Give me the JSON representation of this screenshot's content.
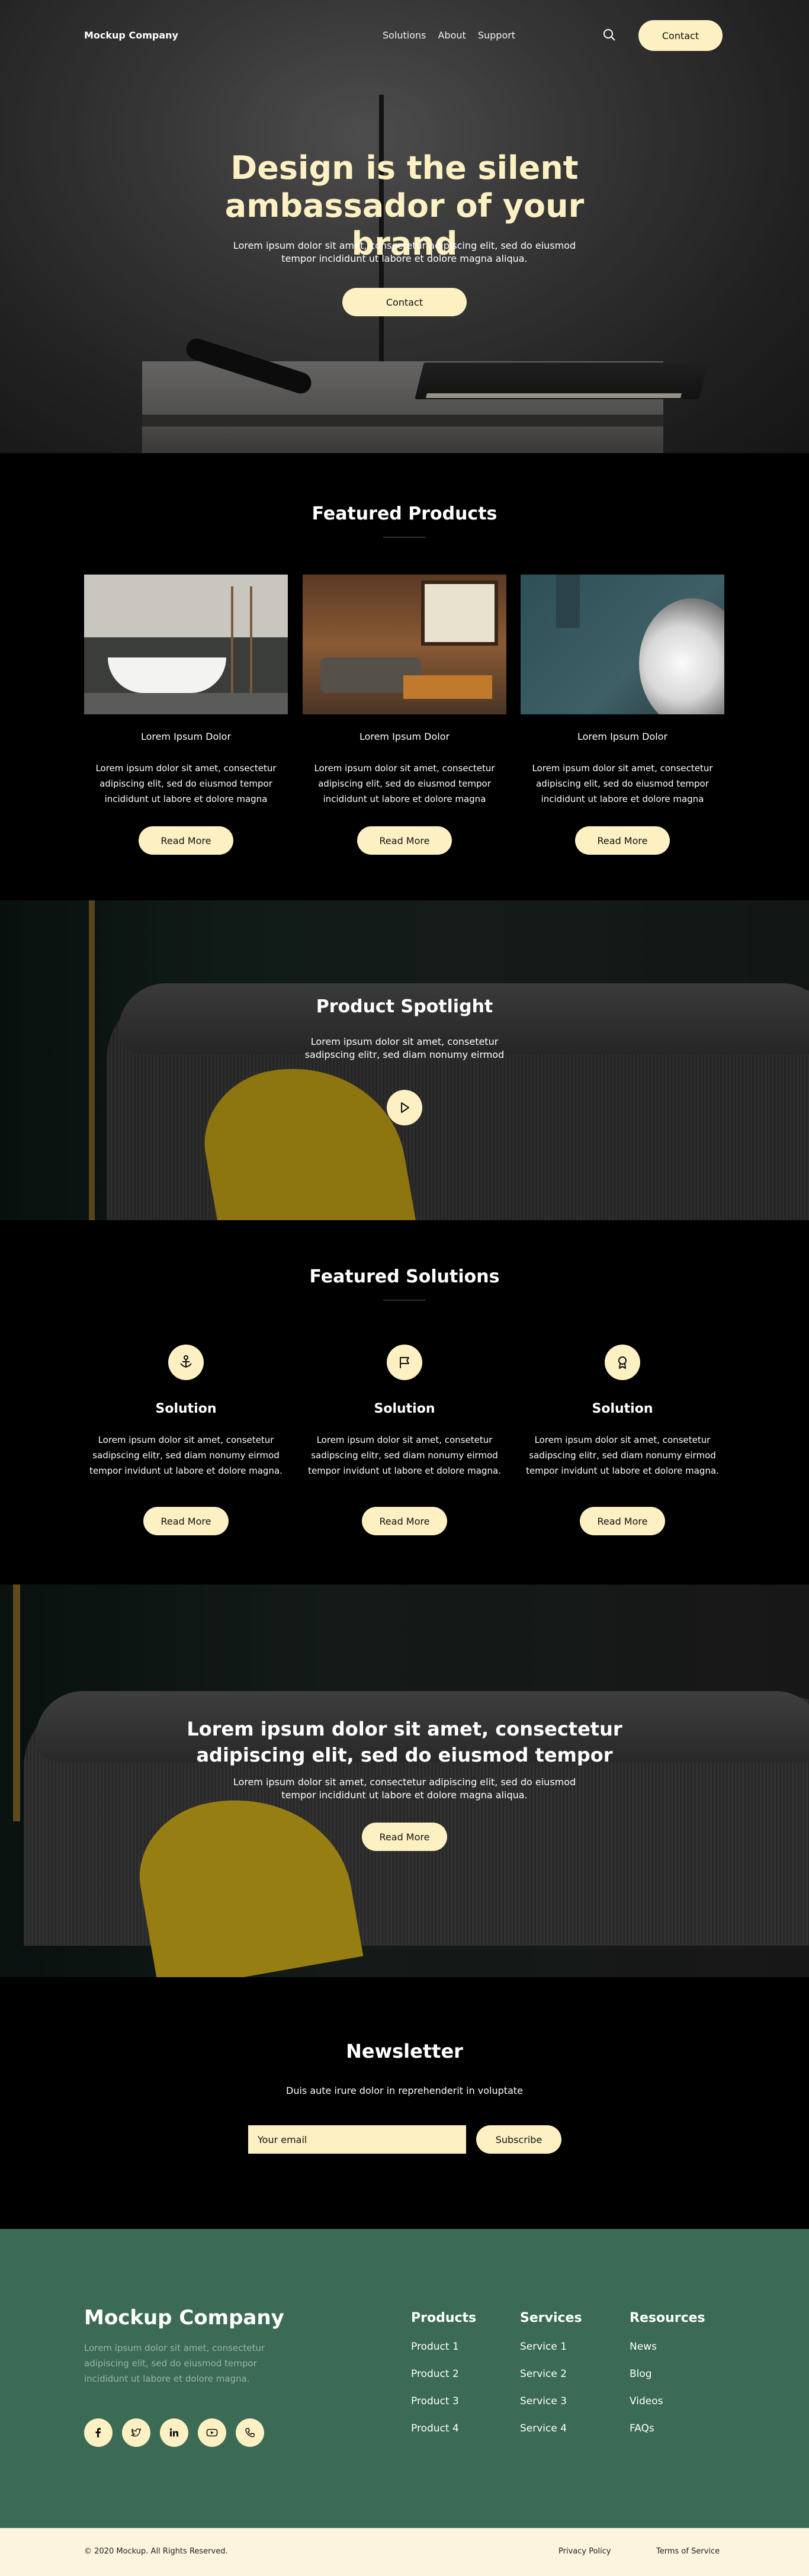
{
  "nav": {
    "logo": "Mockup Company",
    "links": [
      "Solutions",
      "About",
      "Support"
    ],
    "contact": "Contact",
    "search_icon": "search-icon"
  },
  "hero": {
    "title": "Design is the silent ambassador of your brand",
    "subtitle": "Lorem ipsum dolor sit amet, consectetur adipiscing elit, sed do eiusmod tempor incididunt ut labore et dolore magna aliqua.",
    "button": "Contact"
  },
  "featured_products": {
    "title": "Featured Products",
    "cards": [
      {
        "title": "Lorem Ipsum Dolor",
        "text": "Lorem ipsum dolor sit amet, consectetur adipiscing elit, sed do eiusmod tempor incididunt ut labore et dolore magna",
        "button": "Read More"
      },
      {
        "title": "Lorem Ipsum Dolor",
        "text": "Lorem ipsum dolor sit amet, consectetur adipiscing elit, sed do eiusmod tempor incididunt ut labore et dolore magna",
        "button": "Read More"
      },
      {
        "title": "Lorem Ipsum Dolor",
        "text": "Lorem ipsum dolor sit amet, consectetur adipiscing elit, sed do eiusmod tempor incididunt ut labore et dolore magna",
        "button": "Read More"
      }
    ]
  },
  "spotlight": {
    "title": "Product Spotlight",
    "subtitle": "Lorem ipsum dolor sit amet, consetetur sadipscing elitr, sed diam nonumy eirmod"
  },
  "solutions": {
    "title": "Featured Solutions",
    "items": [
      {
        "icon": "anchor-icon",
        "title": "Solution",
        "text": "Lorem ipsum dolor sit amet, consetetur sadipscing elitr, sed diam nonumy eirmod tempor invidunt ut labore et dolore magna.",
        "button": "Read More"
      },
      {
        "icon": "flag-icon",
        "title": "Solution",
        "text": "Lorem ipsum dolor sit amet, consetetur sadipscing elitr, sed diam nonumy eirmod tempor invidunt ut labore et dolore magna.",
        "button": "Read More"
      },
      {
        "icon": "award-icon",
        "title": "Solution",
        "text": "Lorem ipsum dolor sit amet, consetetur sadipscing elitr, sed diam nonumy eirmod tempor invidunt ut labore et dolore magna.",
        "button": "Read More"
      }
    ]
  },
  "promo": {
    "title": "Lorem ipsum dolor sit amet, consectetur adipiscing elit, sed do eiusmod tempor",
    "subtitle": "Lorem ipsum dolor sit amet, consectetur adipiscing elit, sed do eiusmod tempor incididunt ut labore et dolore magna aliqua.",
    "button": "Read More"
  },
  "newsletter": {
    "title": "Newsletter",
    "subtitle": "Duis aute irure dolor in reprehenderit in voluptate",
    "placeholder": "Your email",
    "button": "Subscribe"
  },
  "footer": {
    "brand": "Mockup Company",
    "description": "Lorem ipsum dolor sit amet, consectetur adipiscing elit, sed do eiusmod tempor incididunt ut labore et dolore magna.",
    "socials": [
      "facebook-icon",
      "twitter-icon",
      "linkedin-icon",
      "youtube-icon",
      "phone-icon"
    ],
    "columns": [
      {
        "heading": "Products",
        "items": [
          "Product 1",
          "Product 2",
          "Product 3",
          "Product 4"
        ]
      },
      {
        "heading": "Services",
        "items": [
          "Service 1",
          "Service 2",
          "Service 3",
          "Service 4"
        ]
      },
      {
        "heading": "Resources",
        "items": [
          "News",
          "Blog",
          "Videos",
          "FAQs"
        ]
      }
    ]
  },
  "bottom": {
    "copyright": "© 2020 Mockup.  All Rights Reserved.",
    "privacy": "Privacy Policy",
    "terms": "Terms of Service"
  },
  "colors": {
    "accent": "#fdf0c2",
    "footer_bg": "#3b6b55",
    "bottom_bg": "#fdf4dd"
  }
}
